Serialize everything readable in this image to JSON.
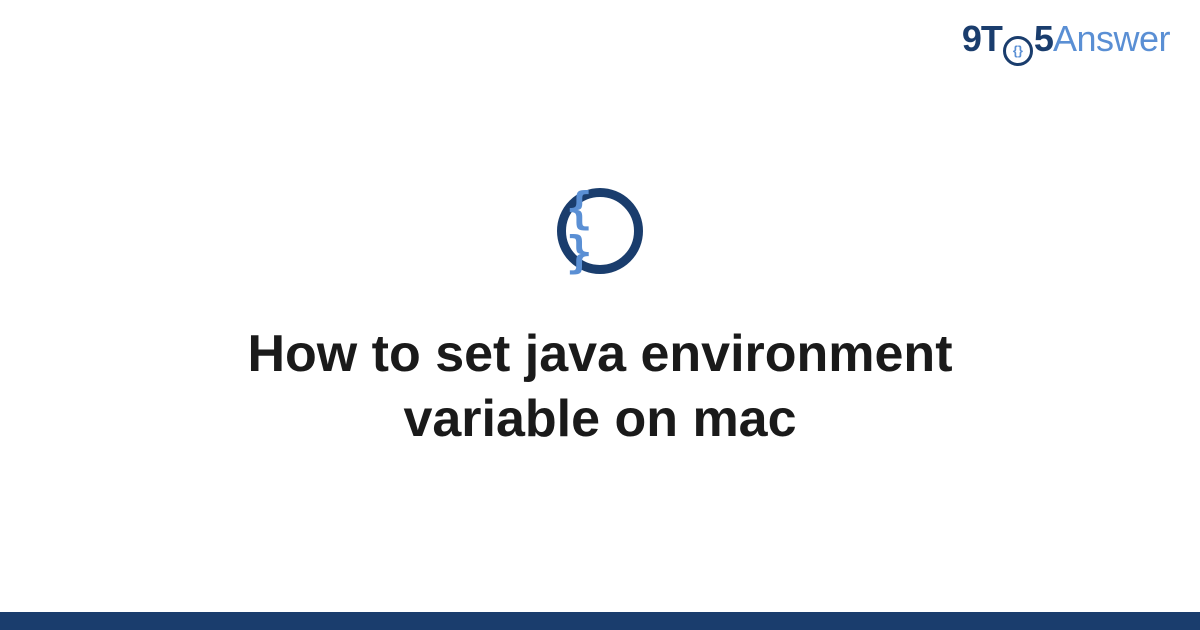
{
  "logo": {
    "part1": "9T",
    "circle_inner": "{}",
    "part2": "5",
    "part3": "Answer"
  },
  "icon": {
    "content": "{ }"
  },
  "title": "How to set java environment variable on mac",
  "colors": {
    "dark_blue": "#1a3d6d",
    "light_blue": "#5a8fd4",
    "text": "#1a1a1a"
  }
}
